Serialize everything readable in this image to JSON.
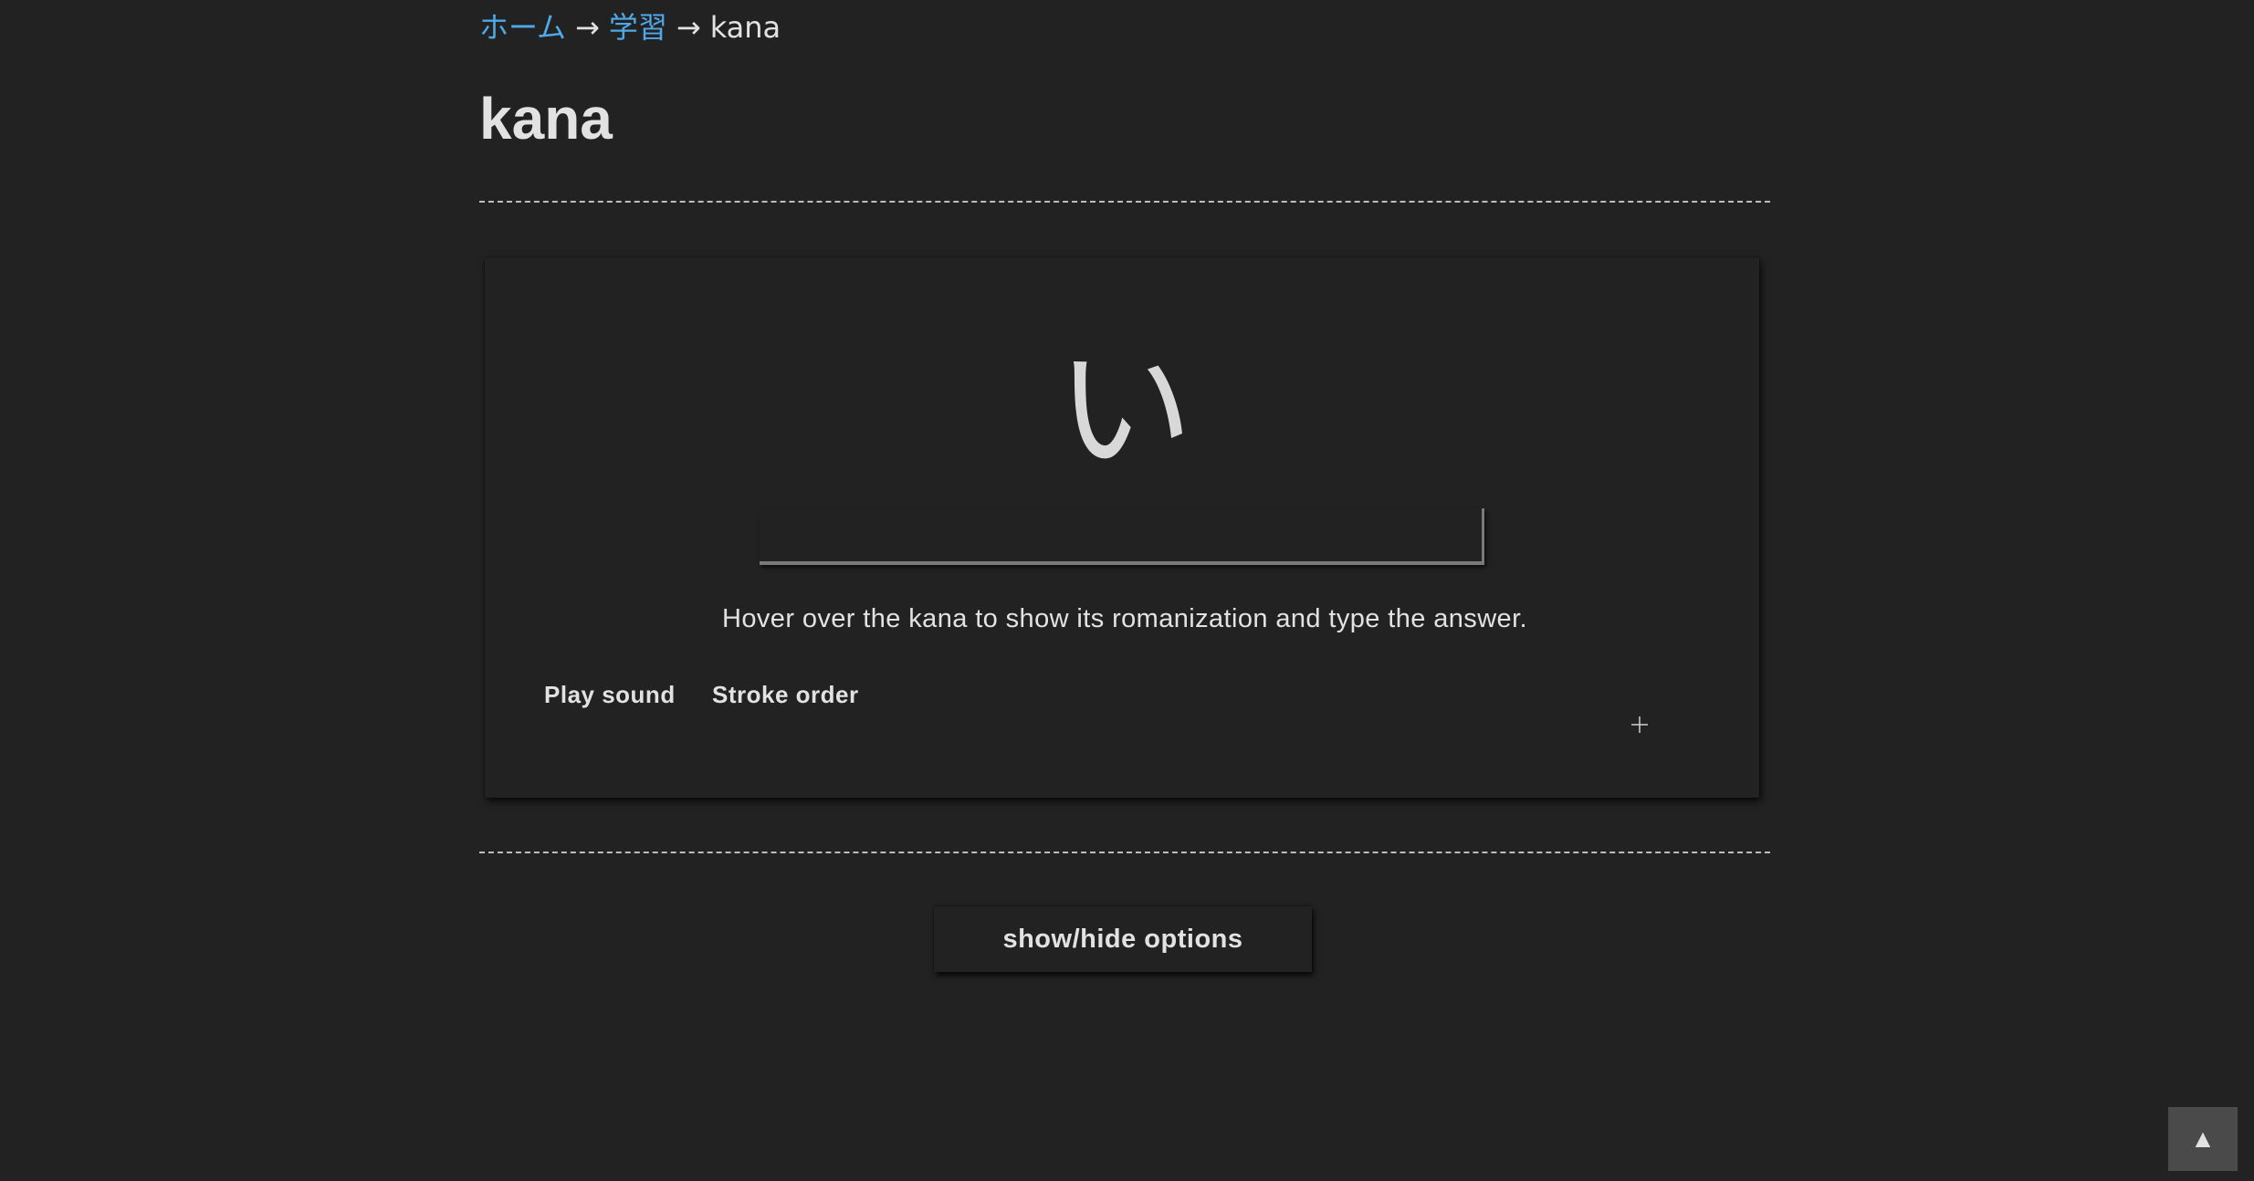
{
  "breadcrumb": {
    "home": "ホーム",
    "separator": "→",
    "study": "学習",
    "current": "kana"
  },
  "page_title": "kana",
  "quiz": {
    "kana": "い",
    "answer_value": "",
    "hint": "Hover over the kana to show its romanization and type the answer.",
    "play_sound_label": "Play sound",
    "stroke_order_label": "Stroke order",
    "plus_icon": "plus-icon"
  },
  "options_button_label": "show/hide options",
  "back_to_top": {
    "label": "▲",
    "icon": "arrow-up-icon"
  },
  "colors": {
    "background": "#222222",
    "text": "#e2e2e2",
    "link": "#4fa8e8",
    "top_button": "#4a4a4a"
  }
}
